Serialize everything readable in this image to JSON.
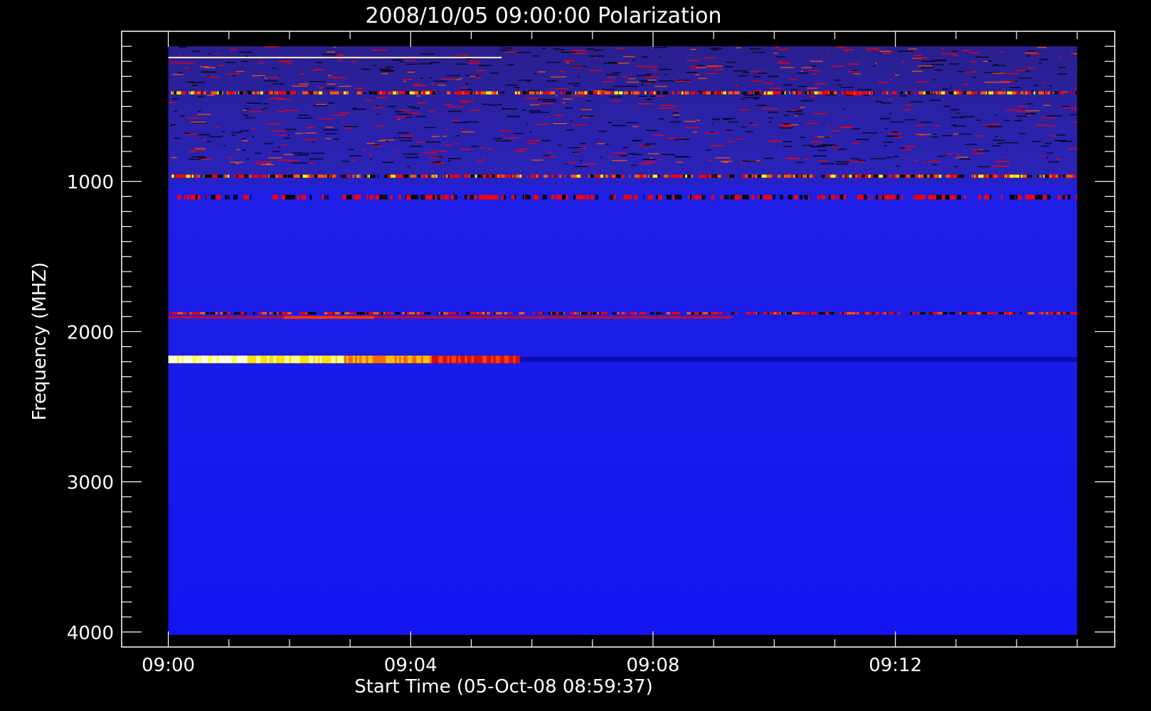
{
  "chart_data": {
    "type": "heatmap",
    "title": "2008/10/05 09:00:00 Polarization",
    "xlabel": "Start Time (05-Oct-08 08:59:37)",
    "ylabel": "Frequency (MHZ)",
    "x_tick_labels": [
      "09:00",
      "09:04",
      "09:08",
      "09:12"
    ],
    "y_tick_labels": [
      "1000",
      "2000",
      "3000",
      "4000"
    ],
    "x_ticks_minutes": [
      0,
      4,
      8,
      12
    ],
    "y_ticks": [
      1000,
      2000,
      3000,
      4000
    ],
    "xlim_minutes": [
      -0.77,
      15.62
    ],
    "ylim": [
      4100,
      0
    ],
    "data_x_range_minutes": [
      0,
      15.0
    ],
    "data_y_range": [
      100,
      4020
    ],
    "grid": false,
    "colormap": [
      "#000000",
      "#0000ff",
      "#ff0000",
      "#ffff00",
      "#ffffff"
    ],
    "features": [
      {
        "freq_mhz": [
          100,
          900
        ],
        "kind": "noisy-band",
        "intensity": 0.55
      },
      {
        "freq_mhz": [
          170,
          180
        ],
        "kind": "bright-line",
        "t_start": 0,
        "t_end": 5.5,
        "intensity": 0.95
      },
      {
        "freq_mhz": [
          400,
          420
        ],
        "kind": "speckled-line",
        "t_start": 0,
        "t_end": 15,
        "intensity": 0.85
      },
      {
        "freq_mhz": [
          955,
          975
        ],
        "kind": "speckled-line",
        "t_start": 0,
        "t_end": 15,
        "intensity": 0.8
      },
      {
        "freq_mhz": [
          1090,
          1120
        ],
        "kind": "faint-speckle",
        "t_start": 0,
        "t_end": 15,
        "intensity": 0.45
      },
      {
        "freq_mhz": [
          1870,
          1885
        ],
        "kind": "speckled-line",
        "t_start": 0,
        "t_end": 15,
        "intensity": 0.6
      },
      {
        "freq_mhz": [
          1895,
          1915
        ],
        "kind": "red-line",
        "t_start": 0,
        "t_end": 9.3,
        "intensity": 0.6
      },
      {
        "freq_mhz": [
          2160,
          2210
        ],
        "kind": "fading-burst",
        "t_start": 0,
        "t_end": 5.8,
        "intensity": 1.0
      }
    ]
  }
}
